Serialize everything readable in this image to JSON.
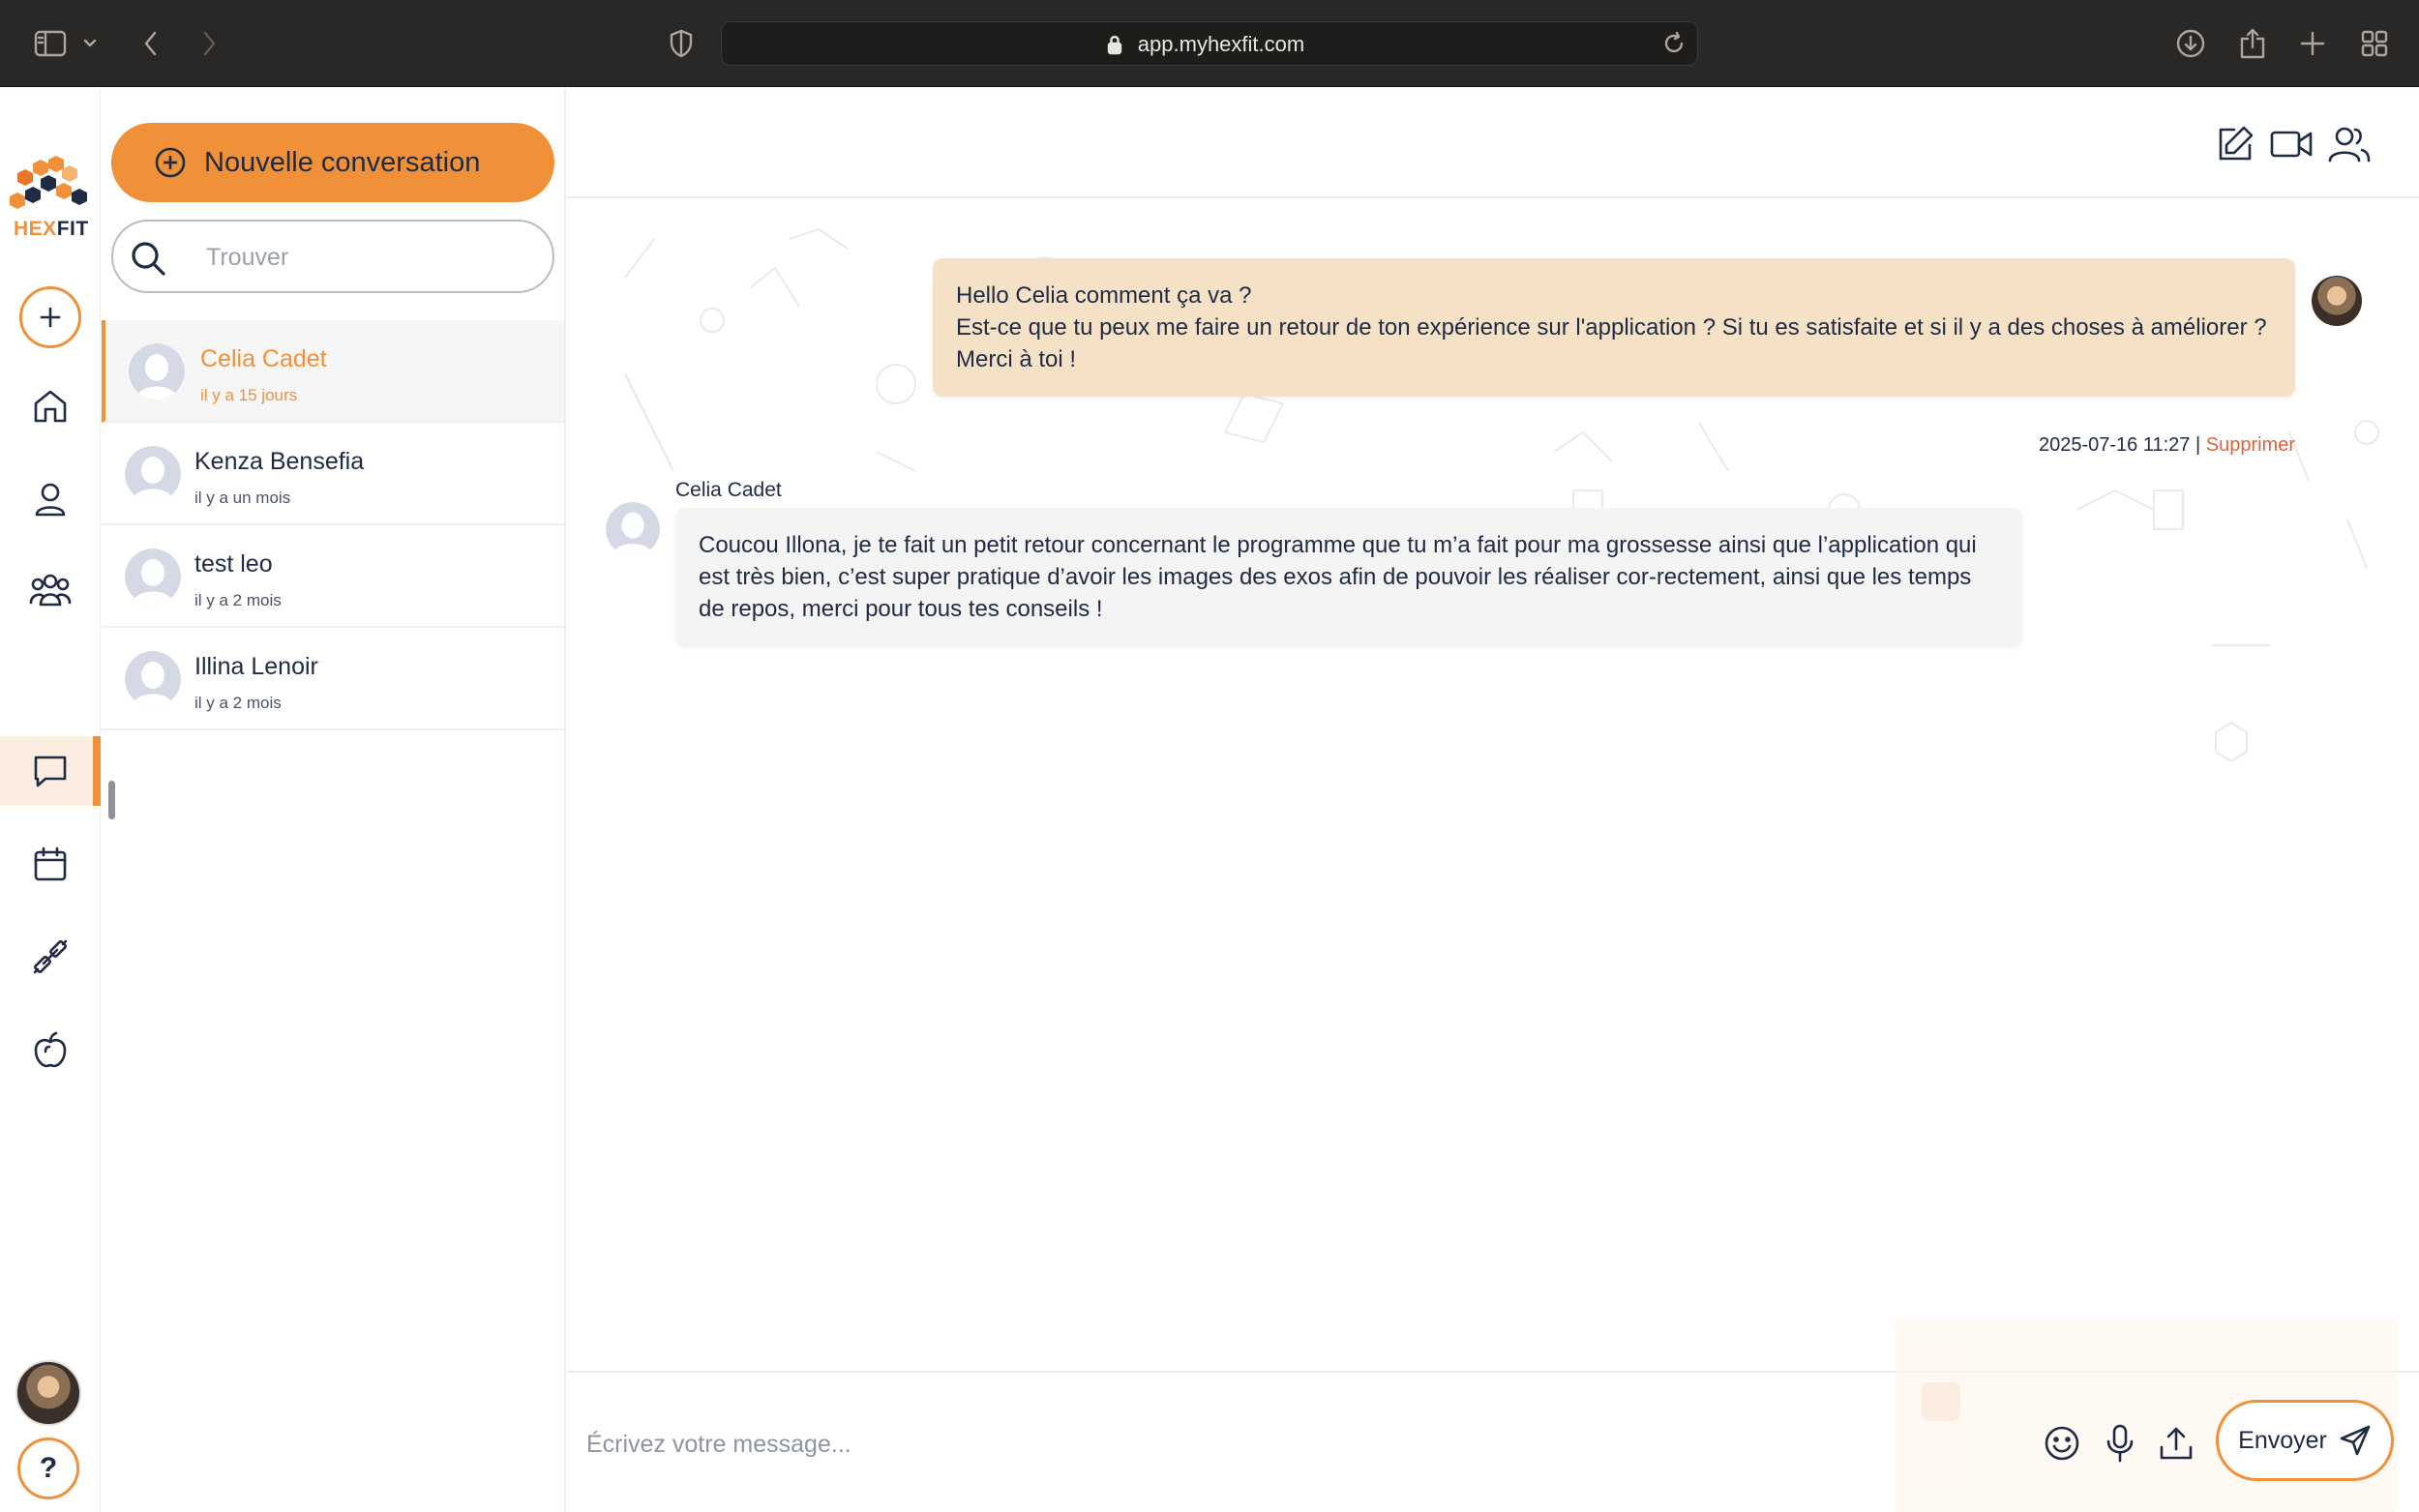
{
  "browser": {
    "url": "app.myhexfit.com",
    "icons": [
      "sidebar-toggle-icon",
      "chevron-down-icon",
      "back-icon",
      "forward-icon",
      "shield-icon",
      "lock-icon",
      "reload-icon",
      "download-icon",
      "share-icon",
      "new-tab-icon",
      "tabs-grid-icon"
    ]
  },
  "brand": {
    "part1": "HEX",
    "part2": "FIT",
    "accent_color": "#f0913a",
    "navy_color": "#1f2a44"
  },
  "rail": {
    "items": [
      {
        "icon": "plus-icon"
      },
      {
        "icon": "home-icon"
      },
      {
        "icon": "user-icon"
      },
      {
        "icon": "group-icon"
      },
      {
        "icon": "chat-icon",
        "active": true
      },
      {
        "icon": "calendar-icon"
      },
      {
        "icon": "dumbbell-icon"
      },
      {
        "icon": "apple-icon"
      }
    ],
    "help_label": "?"
  },
  "conversations": {
    "new_label": "Nouvelle conversation",
    "search_placeholder": "Trouver",
    "items": [
      {
        "name": "Celia Cadet",
        "time": "il y a 15 jours",
        "active": true
      },
      {
        "name": "Kenza Bensefia",
        "time": "il y a un mois"
      },
      {
        "name": "test leo",
        "time": "il y a 2 mois"
      },
      {
        "name": "Illina Lenoir",
        "time": "il y a 2 mois"
      }
    ]
  },
  "chat": {
    "header_icons": [
      "edit-icon",
      "video-icon",
      "users-icon"
    ],
    "messages": [
      {
        "direction": "out",
        "text": "Hello Celia comment ça va ?\nEst-ce que tu peux me faire un retour de ton expérience sur l'application ? Si tu es satisfaite et si il y a des choses à améliorer ?\nMerci à toi !",
        "timestamp": "2025-07-16 11:27",
        "separator": " | ",
        "delete_label": "Supprimer"
      },
      {
        "direction": "in",
        "sender": "Celia Cadet",
        "text": "Coucou Illona, je te fait un petit retour concernant le programme que tu m’a fait pour ma grossesse ainsi que l’application qui est très bien, c’est super pratique d’avoir les images des exos afin de pouvoir les réaliser cor-rectement, ainsi que les temps de repos, merci pour tous tes conseils !"
      }
    ],
    "composer": {
      "placeholder": "Écrivez votre message...",
      "send_label": "Envoyer",
      "icons": [
        "emoji-icon",
        "microphone-icon",
        "upload-icon",
        "send-icon"
      ]
    }
  }
}
